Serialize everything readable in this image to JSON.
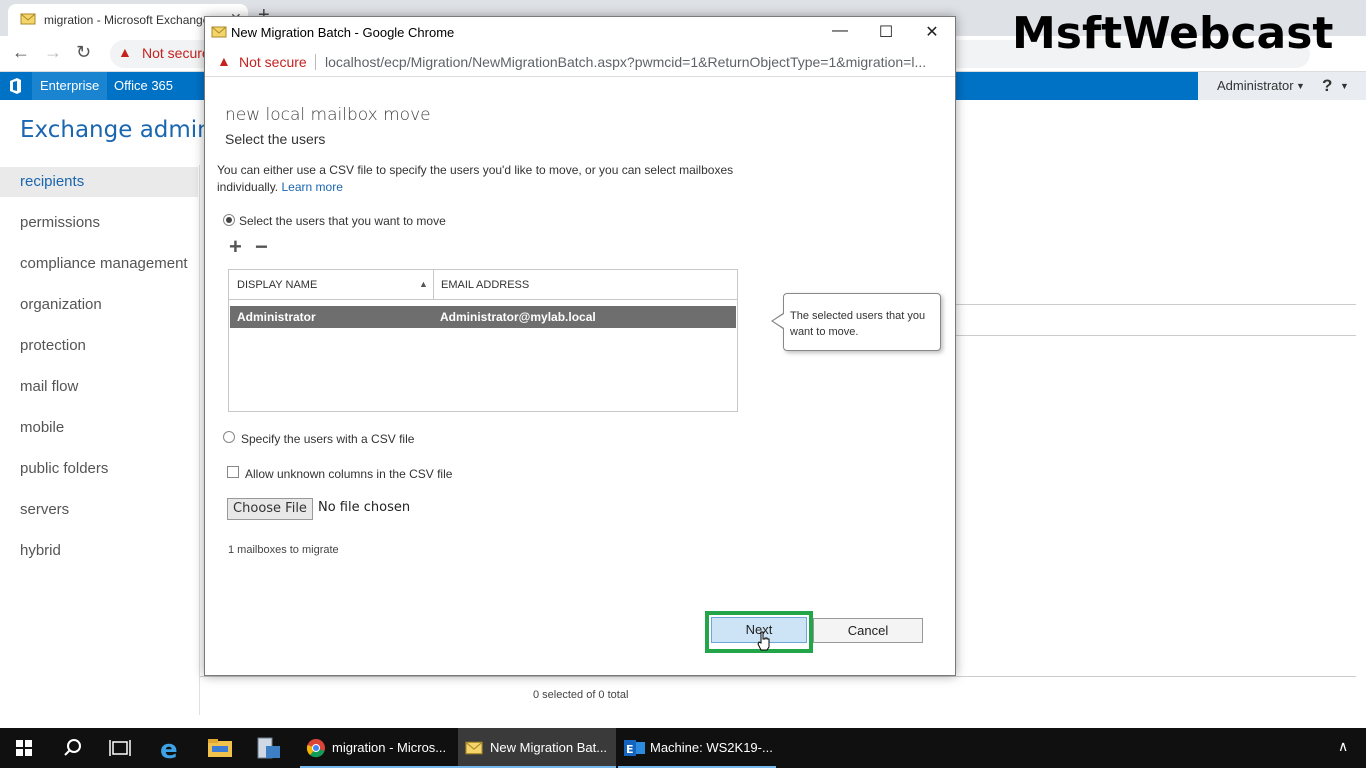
{
  "browser": {
    "tab_title": "migration - Microsoft Exchange",
    "omnibox_security": "Not secure",
    "watermark": "MsftWebcast"
  },
  "eac": {
    "nav": {
      "enterprise": "Enterprise",
      "office365": "Office 365"
    },
    "user": "Administrator",
    "help": "?",
    "title": "Exchange admin center",
    "sidebar": [
      {
        "label": "recipients",
        "active": true
      },
      {
        "label": "permissions"
      },
      {
        "label": "compliance management"
      },
      {
        "label": "organization"
      },
      {
        "label": "protection"
      },
      {
        "label": "mail flow"
      },
      {
        "label": "mobile"
      },
      {
        "label": "public folders"
      },
      {
        "label": "servers"
      },
      {
        "label": "hybrid"
      }
    ],
    "status": "0 selected of 0 total"
  },
  "popup": {
    "window_title": "New Migration Batch - Google Chrome",
    "security": "Not secure",
    "url": "localhost/ecp/Migration/NewMigrationBatch.aspx?pwmcid=1&ReturnObjectType=1&migration=l...",
    "heading": "new local mailbox move",
    "subheading": "Select the users",
    "description": "You can either use a CSV file to specify the users you'd like to move, or you can select mailboxes individually.",
    "learn_more": "Learn more",
    "option_select_users": "Select the users that you want to move",
    "option_csv": "Specify the users with a CSV file",
    "allow_unknown_columns": "Allow unknown columns in the CSV file",
    "grid": {
      "columns": [
        "DISPLAY NAME",
        "EMAIL ADDRESS"
      ],
      "rows": [
        {
          "display_name": "Administrator",
          "email": "Administrator@mylab.local"
        }
      ]
    },
    "tooltip": "The selected users that you want to move.",
    "choose_file": "Choose File",
    "no_file": "No file chosen",
    "mailbox_count": "1 mailboxes to migrate",
    "next": "Next",
    "cancel": "Cancel"
  },
  "taskbar": {
    "apps": [
      {
        "label": "migration - Micros..."
      },
      {
        "label": "New Migration Bat..."
      },
      {
        "label": "Machine: WS2K19-..."
      }
    ]
  },
  "colors": {
    "eac_blue": "#0072c6",
    "highlight_green": "#23a64a",
    "selected_row": "#6e6e6e"
  }
}
